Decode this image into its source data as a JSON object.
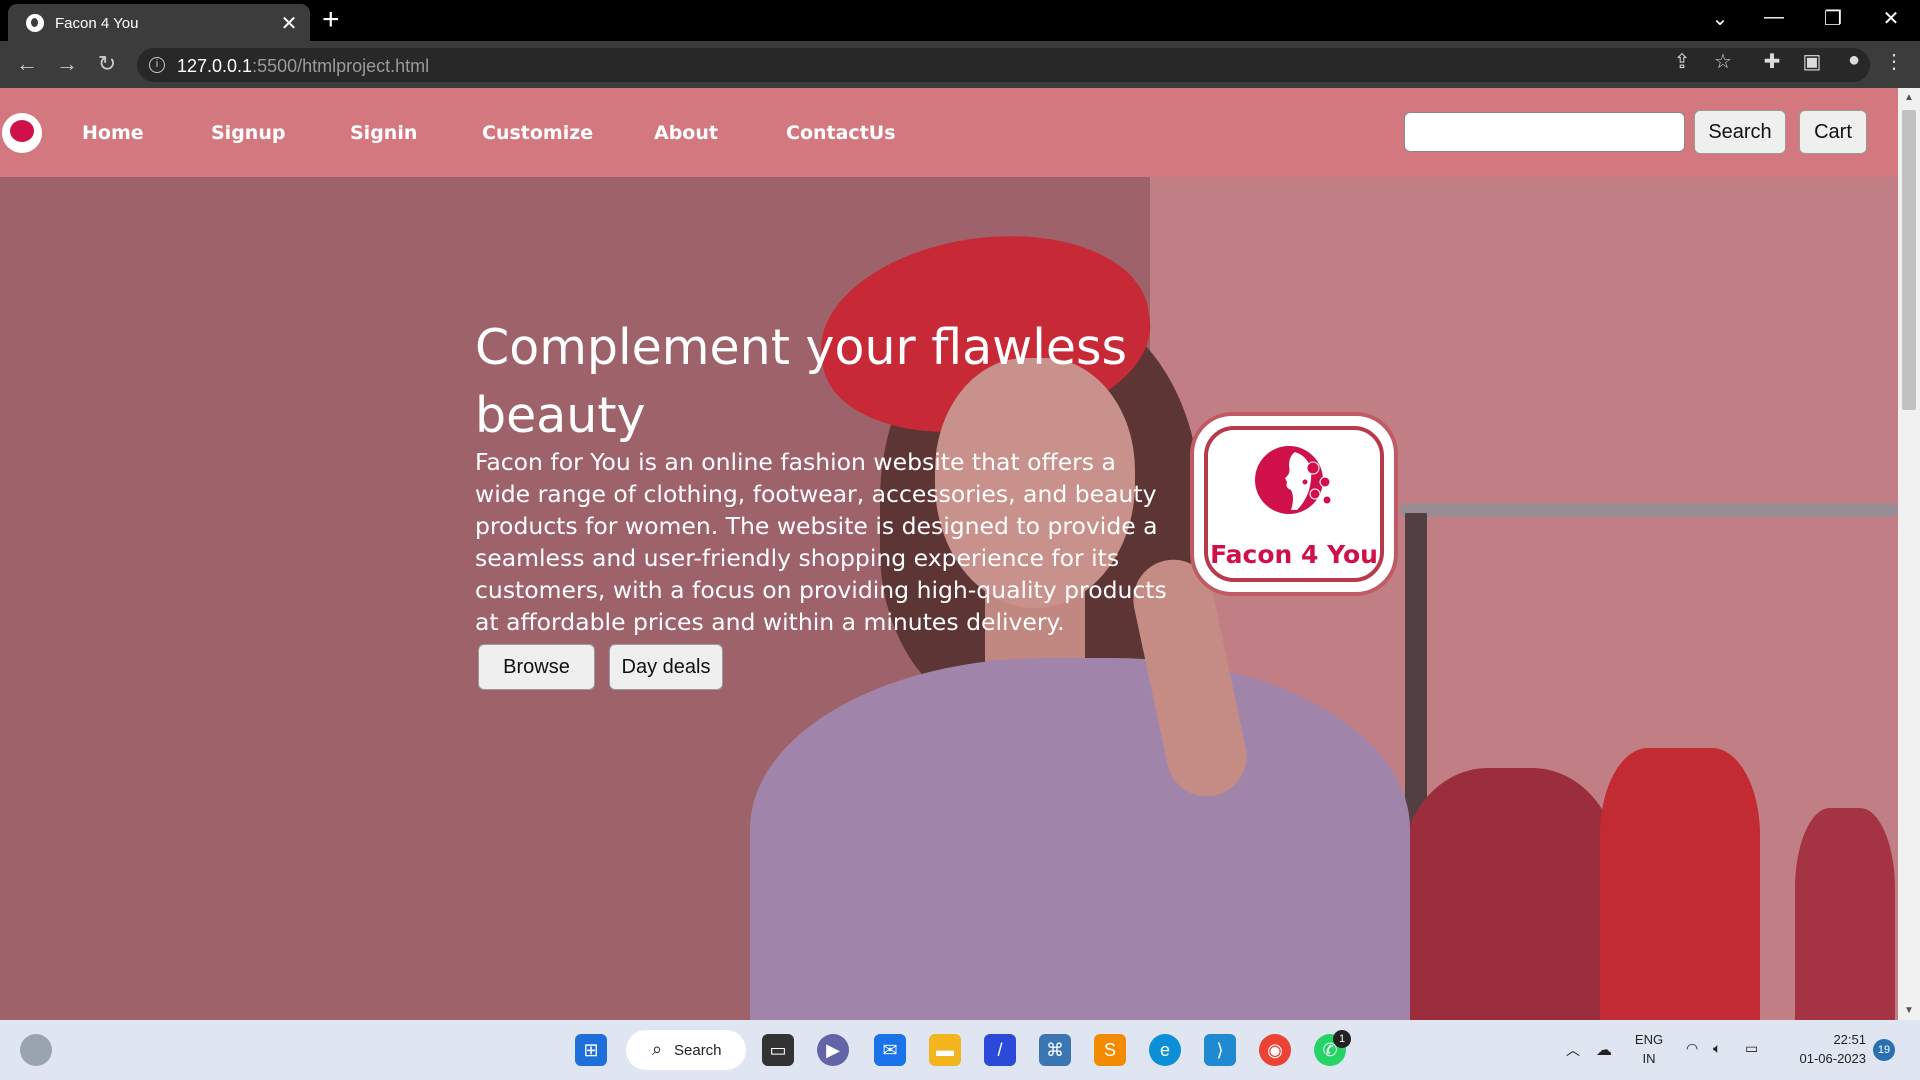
{
  "browser": {
    "tab_title": "Facon 4 You",
    "tab_close": "✕",
    "new_tab": "+",
    "url_host": "127.0.0.1",
    "url_rest": ":5500/htmlproject.html",
    "window_controls": {
      "dropdown": "⌄",
      "minimize": "—",
      "maximize": "❐",
      "close": "✕"
    },
    "nav": {
      "back": "←",
      "forward": "→",
      "reload": "↻"
    },
    "toolbar_icons": [
      "share-icon",
      "star-icon",
      "extensions-icon",
      "sidepanel-icon",
      "profile-icon",
      "menu-icon"
    ]
  },
  "navbar": {
    "links": [
      "Home",
      "Signup",
      "Signin",
      "Customize",
      "About",
      "ContactUs"
    ],
    "search_button": "Search",
    "cart_button": "Cart",
    "search_value": ""
  },
  "hero": {
    "title": "Complement your flawless beauty",
    "description": "Facon for You is an online fashion website that offers a wide range of clothing, footwear, accessories, and beauty products for women. The website is designed to provide a seamless and user-friendly shopping experience for its customers, with a focus on providing high-quality products at affordable prices and within a minutes delivery.",
    "browse_button": "Browse",
    "deals_button": "Day deals",
    "badge_text": "Facon 4 You"
  },
  "taskbar": {
    "search_label": "Search",
    "whatsapp_badge": "1",
    "lang_top": "ENG",
    "lang_bottom": "IN",
    "time": "22:51",
    "date": "01-06-2023",
    "notifications": "19"
  },
  "colors": {
    "navbar": "#d4787f",
    "brand": "#d0104a"
  }
}
